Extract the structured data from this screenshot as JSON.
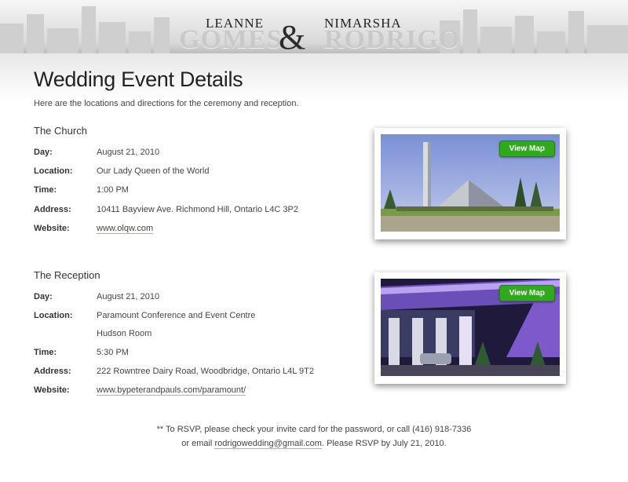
{
  "header": {
    "bride_first": "LEANNE",
    "bride_last": "GOMES",
    "ampersand": "&",
    "groom_first": "NIMARSHA",
    "groom_last": "RODRIGO"
  },
  "page": {
    "title": "Wedding Event Details",
    "intro": "Here are the locations and directions for the ceremony and reception."
  },
  "church": {
    "title": "The Church",
    "day_label": "Day:",
    "day": "August 21, 2010",
    "location_label": "Location:",
    "location": "Our Lady Queen of the World",
    "time_label": "Time:",
    "time": "1:00 PM",
    "address_label": "Address:",
    "address": "10411 Bayview Ave. Richmond Hill, Ontario L4C 3P2",
    "website_label": "Website:",
    "website": "www.olqw.com",
    "map_button": "View Map"
  },
  "reception": {
    "title": "The Reception",
    "day_label": "Day:",
    "day": "August 21, 2010",
    "location_label": "Location:",
    "location": "Paramount Conference and Event Centre",
    "room": "Hudson Room",
    "time_label": "Time:",
    "time": "5:30 PM",
    "address_label": "Address:",
    "address": "222 Rowntree Dairy Road, Woodbridge, Ontario L4L 9T2",
    "website_label": "Website:",
    "website": "www.bypeterandpauls.com/paramount/",
    "map_button": "View Map"
  },
  "footer": {
    "line1": "** To RSVP, please check your invite card for the password, or call (416) 918-7336",
    "line2_prefix": "or email ",
    "email": "rodrigowedding@gmail.com",
    "line2_suffix": ". Please RSVP by July 21, 2010."
  },
  "colors": {
    "map_button": "#31a81f",
    "link_underline": "#c8a9a9"
  }
}
